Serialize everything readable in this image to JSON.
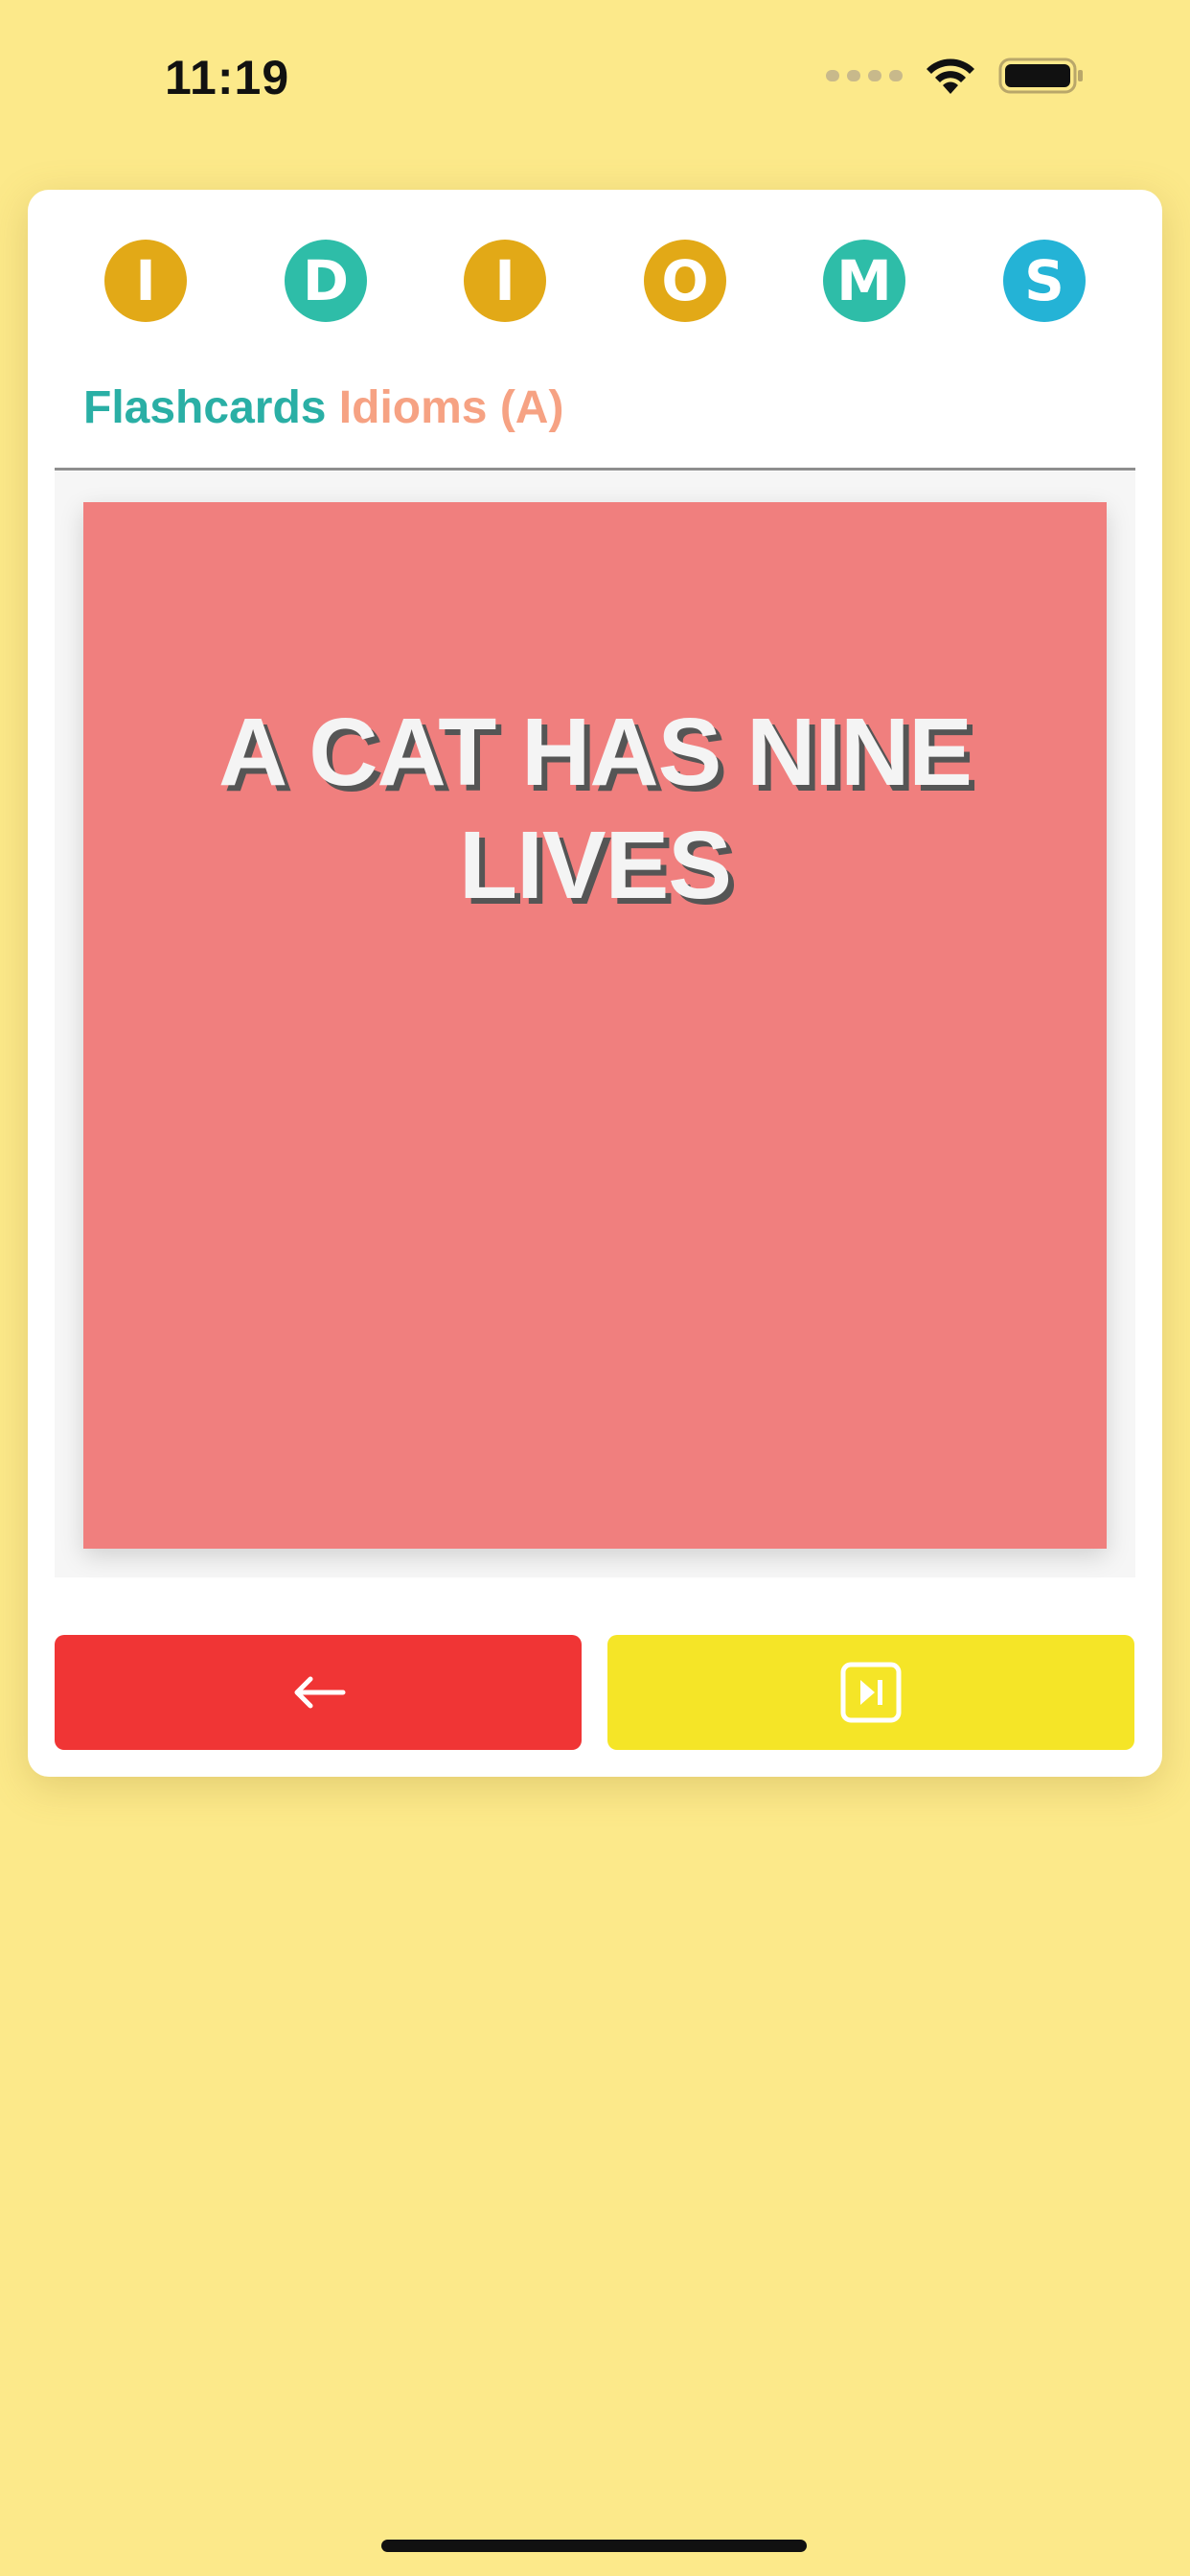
{
  "status_bar": {
    "time": "11:19"
  },
  "header": {
    "letters": [
      {
        "char": "I",
        "color": "#E2A917"
      },
      {
        "char": "D",
        "color": "#2EBDA8"
      },
      {
        "char": "I",
        "color": "#E2A917"
      },
      {
        "char": "O",
        "color": "#E2A917"
      },
      {
        "char": "M",
        "color": "#2EBDA8"
      },
      {
        "char": "S",
        "color": "#24B3D6"
      }
    ],
    "title_primary": "Flashcards",
    "title_secondary": "Idioms (A)"
  },
  "flashcard": {
    "text": "A CAT HAS NINE LIVES",
    "background": "#F07F7E"
  },
  "buttons": {
    "back_icon": "arrow-left-icon",
    "next_icon": "skip-next-icon",
    "back_color": "#F03535",
    "next_color": "#F5E527"
  },
  "colors": {
    "page_background": "#FCE98A",
    "title_primary": "#2AAFA5",
    "title_secondary": "#F6A283"
  }
}
